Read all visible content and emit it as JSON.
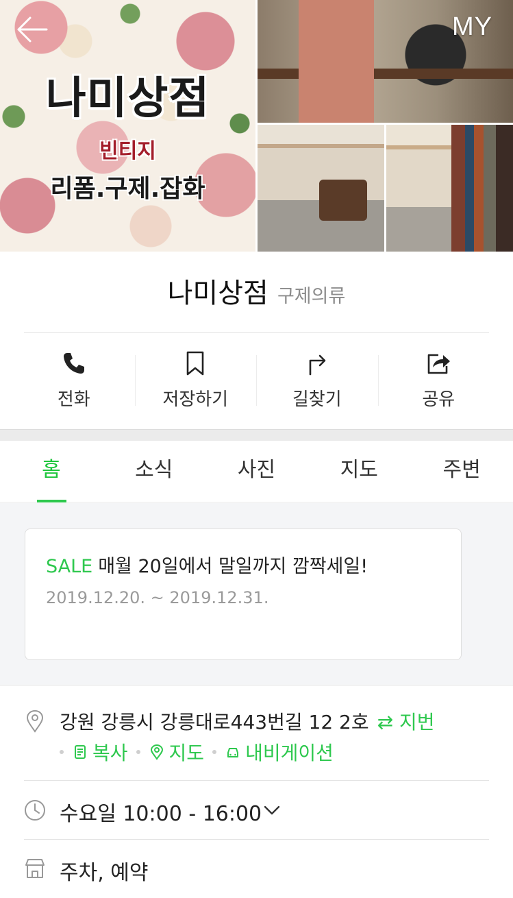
{
  "header": {
    "sign_title": "나미상점",
    "sign_subtitle": "빈티지",
    "sign_tagline": "리폼.구제.잡화",
    "my_label": "MY",
    "back_icon": "arrow-left-icon"
  },
  "place": {
    "name": "나미상점",
    "category": "구제의류"
  },
  "actions": [
    {
      "label": "전화",
      "icon": "phone-icon"
    },
    {
      "label": "저장하기",
      "icon": "bookmark-icon"
    },
    {
      "label": "길찾기",
      "icon": "directions-icon"
    },
    {
      "label": "공유",
      "icon": "share-icon"
    }
  ],
  "tabs": [
    {
      "label": "홈",
      "active": true
    },
    {
      "label": "소식",
      "active": false
    },
    {
      "label": "사진",
      "active": false
    },
    {
      "label": "지도",
      "active": false
    },
    {
      "label": "주변",
      "active": false
    }
  ],
  "notice": {
    "tag": "SALE",
    "text": "매월 20일에서 말일까지 깜짝세일!",
    "date_range": "2019.12.20. ~ 2019.12.31."
  },
  "address": {
    "text": "강원 강릉시 강릉대로443번길 12 2호",
    "toggle_label": "지번",
    "links": [
      {
        "label": "복사",
        "icon": "copy-icon"
      },
      {
        "label": "지도",
        "icon": "map-pin-icon"
      },
      {
        "label": "내비게이션",
        "icon": "car-icon"
      }
    ]
  },
  "hours": {
    "text": "수요일 10:00 - 16:00"
  },
  "amenities": {
    "text": "주차, 예약"
  },
  "colors": {
    "accent": "#2ec84e",
    "text_primary": "#222222",
    "text_secondary": "#8c8c8c"
  }
}
